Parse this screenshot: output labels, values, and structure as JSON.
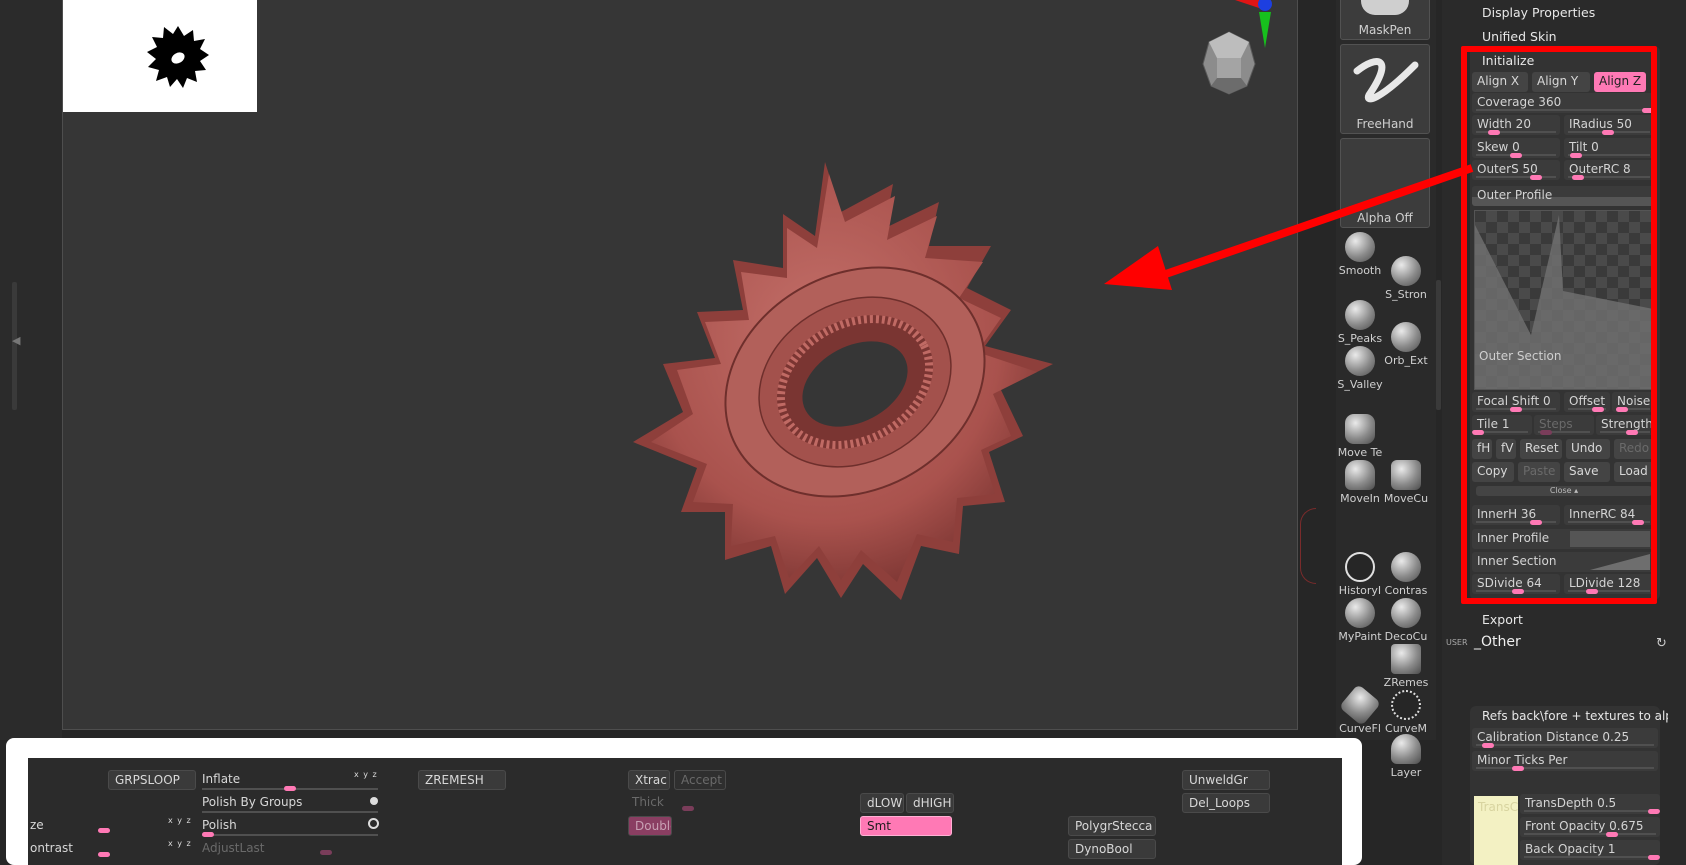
{
  "canvas": {
    "label": "3D viewport",
    "model_color": "#b55a55",
    "annotation_color": "#ff0000"
  },
  "brushes": {
    "tiles": [
      {
        "label": "MaskPen"
      },
      {
        "label": "FreeHand"
      },
      {
        "label": "Alpha Off"
      }
    ],
    "icons": [
      {
        "label": "Smooth"
      },
      {
        "label": "S_Stron"
      },
      {
        "label": "S_Peaks"
      },
      {
        "label": "Orb_Ext"
      },
      {
        "label": "S_Valley"
      },
      {
        "label": "Move Te"
      },
      {
        "label": "MoveIn"
      },
      {
        "label": "MoveCu"
      },
      {
        "label": "HistoryI"
      },
      {
        "label": "Contras"
      },
      {
        "label": "MyPaint"
      },
      {
        "label": "DecoCu"
      },
      {
        "label": "ZRemes"
      },
      {
        "label": "CurveFl"
      },
      {
        "label": "CurveM"
      },
      {
        "label": "Layer"
      }
    ]
  },
  "panel": {
    "display_properties": "Display Properties",
    "unified_skin": "Unified Skin",
    "initialize": "Initialize",
    "align_x": "Align X",
    "align_y": "Align Y",
    "align_z": "Align Z",
    "coverage": "Coverage 360",
    "width": "Width 20",
    "iradius": "IRadius 50",
    "skew": "Skew 0",
    "tilt": "Tilt 0",
    "outers": "OuterS 50",
    "outerrc": "OuterRC 8",
    "outer_profile": "Outer Profile",
    "outer_section": "Outer Section",
    "focal_shift": "Focal Shift 0",
    "offset": "Offset",
    "noise": "Noise",
    "tile": "Tile 1",
    "steps": "Steps",
    "strength": "Strength",
    "fh": "fH",
    "fv": "fV",
    "reset": "Reset",
    "undo": "Undo",
    "redo": "Redo",
    "copy": "Copy",
    "paste": "Paste",
    "save": "Save",
    "load": "Load",
    "close": "Close",
    "innerh": "InnerH 36",
    "innerrc": "InnerRC 84",
    "inner_profile": "Inner Profile",
    "inner_section": "Inner Section",
    "sdivide": "SDivide 64",
    "ldivide": "LDivide 128",
    "export": "Export",
    "user_tag": "USER",
    "other": "_Other",
    "refs_title": "Refs back\\fore + textures to alpha",
    "calibration": "Calibration Distance 0.25",
    "minor_ticks": "Minor Ticks Per",
    "transc": "TransC",
    "transdepth": "TransDepth 0.5",
    "front_opacity": "Front Opacity 0.675",
    "back_opacity": "Back Opacity 1"
  },
  "shelf": {
    "grpsloop": "GRPSLOOP",
    "inflate": "Inflate",
    "polish_by_groups": "Polish By Groups",
    "polish": "Polish",
    "adjust_last": "AdjustLast",
    "size_frag": "ze",
    "contrast_frag": "ontrast",
    "zremesh": "ZREMESH",
    "xtrac": "Xtrac",
    "accept": "Accept",
    "thick": "Thick",
    "double": "Double",
    "dlow": "dLOW",
    "dhigh": "dHIGH",
    "smt": "Smt",
    "polygrstecca": "PolygrStecca",
    "dynobool": "DynoBool",
    "unweldgr": "UnweldGr",
    "del_loops": "Del_Loops",
    "xyz": "x y z"
  }
}
